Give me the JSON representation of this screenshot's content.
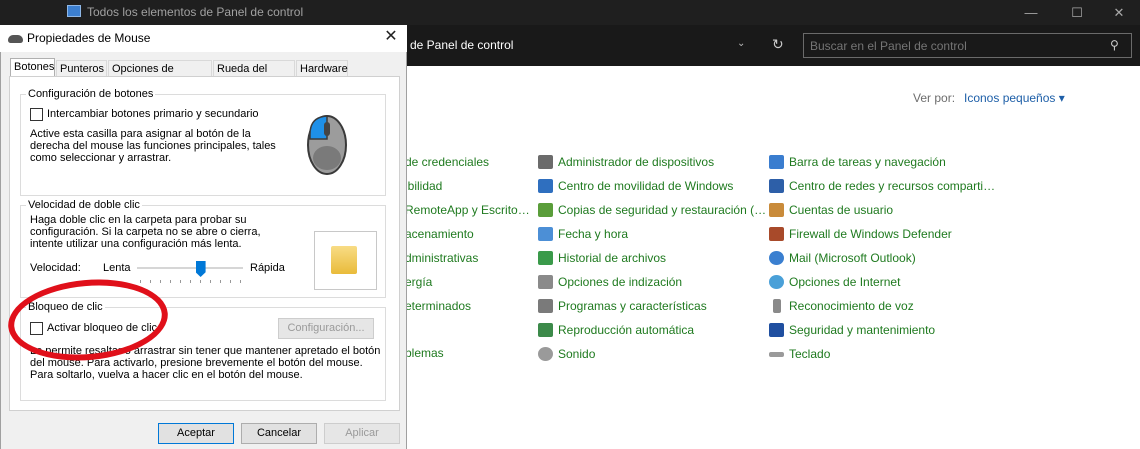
{
  "control_panel": {
    "window_title": "Todos los elementos de Panel de control",
    "address_text": "de Panel de control",
    "search_placeholder": "Buscar en el Panel de control",
    "view_by_label": "Ver por:",
    "view_by_value": "Iconos pequeños ▾",
    "items_col1": [
      "de credenciales",
      "ibilidad",
      "RemoteApp y Escrito…",
      "acenamiento",
      "dministrativas",
      "ergía",
      "eterminados",
      "",
      "blemas"
    ],
    "items_col2": [
      "Administrador de dispositivos",
      "Centro de movilidad de Windows",
      "Copias de seguridad y restauración (…",
      "Fecha y hora",
      "Historial de archivos",
      "Opciones de indización",
      "Programas y características",
      "Reproducción automática",
      "Sonido"
    ],
    "items_col3": [
      "Barra de tareas y navegación",
      "Centro de redes y recursos comparti…",
      "Cuentas de usuario",
      "Firewall de Windows Defender",
      "Mail (Microsoft Outlook)",
      "Opciones de Internet",
      "Reconocimiento de voz",
      "Seguridad y mantenimiento",
      "Teclado"
    ],
    "colors": {
      "link_green": "#1f7a1f",
      "link_blue": "#1e5fa8",
      "dark_title": "#1f1f1f"
    }
  },
  "dialog": {
    "title": "Propiedades de Mouse",
    "close_icon": "✕",
    "tabs": [
      "Botones",
      "Punteros",
      "Opciones de puntero",
      "Rueda del ratón",
      "Hardware"
    ],
    "buttons_group": {
      "title": "Configuración de botones",
      "checkbox_label": "Intercambiar botones primario y secundario",
      "description_lines": [
        "Active esta casilla para asignar al botón de la",
        "derecha del mouse las funciones principales, tales",
        "como seleccionar y arrastrar."
      ]
    },
    "double_click_group": {
      "title": "Velocidad de doble clic",
      "description_lines": [
        "Haga doble clic en la carpeta para probar su",
        "configuración. Si la carpeta no se abre o cierra,",
        "intente utilizar una configuración más lenta."
      ],
      "speed_label": "Velocidad:",
      "slow_label": "Lenta",
      "fast_label": "Rápida",
      "slider_value": 0.6
    },
    "click_lock_group": {
      "title": "Bloqueo de clic",
      "checkbox_label": "Activar bloqueo de clic",
      "config_button": "Configuración...",
      "description_lines": [
        "Le permite resaltar o arrastrar sin tener que mantener apretado el botón",
        "del mouse. Para activarlo, presione brevemente el botón del mouse.",
        "Para soltarlo, vuelva a hacer clic en el botón del mouse."
      ]
    },
    "footer": {
      "ok": "Aceptar",
      "cancel": "Cancelar",
      "apply": "Aplicar"
    }
  }
}
